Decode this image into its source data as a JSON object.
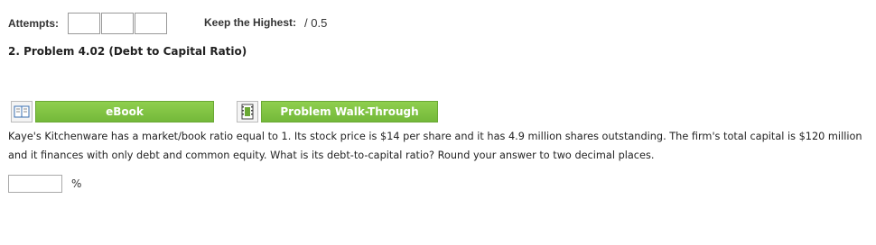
{
  "header": {
    "attempts_label": "Attempts:",
    "keep_label": "Keep the Highest:",
    "keep_score": "/ 0.5"
  },
  "problem": {
    "title": "2.  Problem 4.02 (Debt to Capital Ratio)",
    "ebook_label": "eBook",
    "walkthrough_label": "Problem Walk-Through",
    "question": "Kaye's Kitchenware has a market/book ratio equal to 1. Its stock price is $14 per share and it has 4.9 million shares outstanding. The firm's total capital is $120 million and it finances with only debt and common equity. What is its debt-to-capital ratio? Round your answer to two decimal places.",
    "answer_value": "",
    "answer_unit": "%"
  },
  "icons": {
    "ebook": "book-icon",
    "walkthrough": "film-icon"
  },
  "colors": {
    "button_green": "#7cc043",
    "text": "#222222"
  }
}
